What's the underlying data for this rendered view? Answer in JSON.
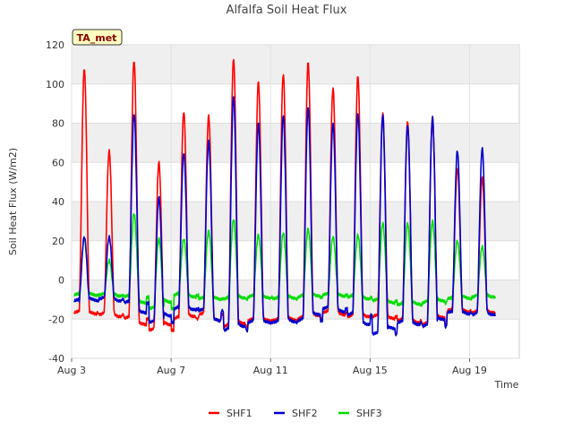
{
  "chart_data": {
    "type": "line",
    "title": "Alfalfa Soil Heat Flux",
    "xlabel": "Time",
    "ylabel": "Soil Heat Flux (W/m2)",
    "badge": "TA_met",
    "x_ticks": [
      "Aug 3",
      "Aug 7",
      "Aug 11",
      "Aug 15",
      "Aug 19"
    ],
    "x_tick_days": [
      3,
      7,
      11,
      15,
      19
    ],
    "xlim_days": [
      3,
      21
    ],
    "ylim": [
      -40,
      120
    ],
    "y_ticks": [
      -40,
      -20,
      0,
      20,
      40,
      60,
      80,
      100,
      120
    ],
    "grid": true,
    "legend_position": "bottom",
    "colors": {
      "SHF1": "#ff0000",
      "SHF2": "#0000cc",
      "SHF3": "#00dd00"
    },
    "series": [
      {
        "name": "SHF1",
        "daily_max": [
          108,
          66,
          112,
          60,
          86,
          84,
          113,
          101,
          105,
          111,
          98,
          104,
          85,
          81,
          83,
          57,
          52
        ],
        "daily_min": [
          -17,
          -18,
          -20,
          -26,
          -20,
          -18,
          -24,
          -21,
          -21,
          -20,
          -17,
          -19,
          -19,
          -21,
          -23,
          -16,
          -17
        ]
      },
      {
        "name": "SHF2",
        "daily_max": [
          22,
          22,
          85,
          42,
          65,
          71,
          94,
          80,
          84,
          88,
          80,
          85,
          84,
          79,
          83,
          66,
          67
        ],
        "daily_min": [
          -11,
          -10,
          -12,
          -22,
          -15,
          -16,
          -26,
          -22,
          -22,
          -21,
          -15,
          -18,
          -28,
          -22,
          -24,
          -17,
          -18
        ]
      },
      {
        "name": "SHF3",
        "daily_max": [
          21,
          10,
          34,
          21,
          21,
          25,
          31,
          23,
          24,
          26,
          22,
          23,
          29,
          29,
          30,
          20,
          17
        ],
        "daily_min": [
          -8,
          -8,
          -9,
          -15,
          -8,
          -10,
          -10,
          -9,
          -10,
          -9,
          -8,
          -9,
          -11,
          -13,
          -12,
          -10,
          -9
        ]
      }
    ]
  }
}
